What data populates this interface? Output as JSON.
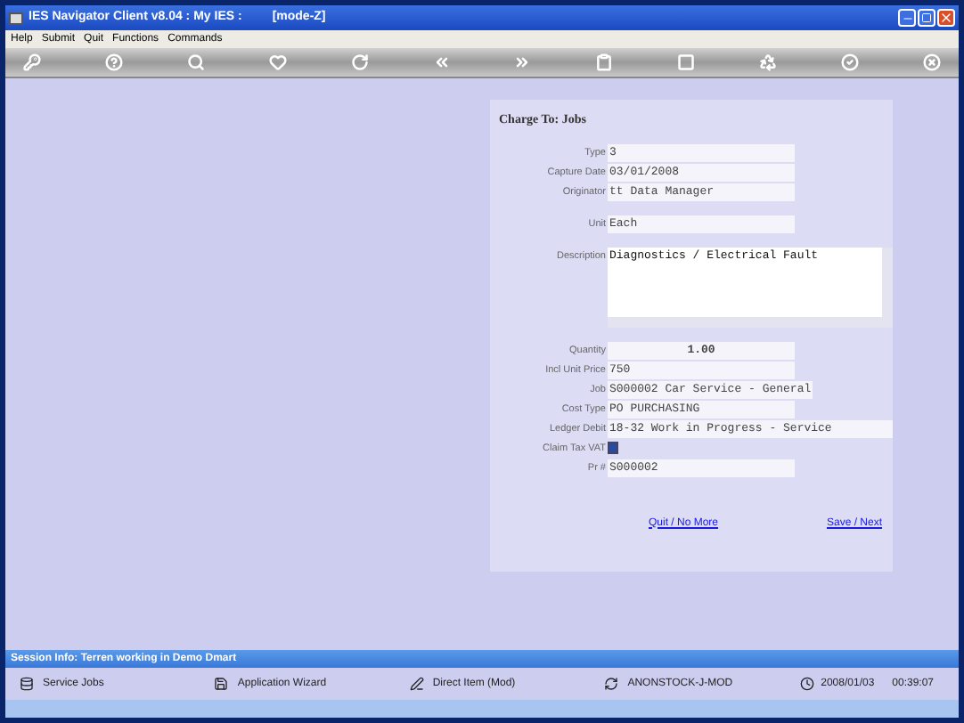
{
  "window": {
    "title": "IES Navigator Client v8.04 : My IES :",
    "mode": "[mode-Z]"
  },
  "menu": [
    "Help",
    "Submit",
    "Quit",
    "Functions",
    "Commands"
  ],
  "form": {
    "title": "Charge To: Jobs",
    "groups": [
      [
        {
          "kind": "field",
          "label": "Type",
          "value": "3"
        },
        {
          "kind": "field",
          "label": "Capture Date",
          "value": "03/01/2008"
        },
        {
          "kind": "field",
          "label": "Originator",
          "value": "tt Data Manager"
        }
      ],
      [
        {
          "kind": "field",
          "label": "Unit",
          "value": "Each"
        }
      ],
      [
        {
          "kind": "textarea",
          "label": "Description",
          "value": "Diagnostics / Electrical Fault"
        }
      ],
      [
        {
          "kind": "number",
          "label": "Quantity",
          "value": "1.00"
        },
        {
          "kind": "field",
          "label": "Incl Unit Price",
          "value": "750"
        },
        {
          "kind": "field",
          "label": "Job",
          "value": "S000002 Car Service - General"
        },
        {
          "kind": "field",
          "label": "Cost Type",
          "value": "PO PURCHASING"
        },
        {
          "kind": "wide",
          "label": "Ledger Debit",
          "value": "18-32 Work in Progress - Service"
        },
        {
          "kind": "checkbox",
          "label": "Claim Tax VAT",
          "checked": true
        },
        {
          "kind": "field",
          "label": "Pr #",
          "value": "S000002"
        }
      ]
    ],
    "links": [
      "Quit / No More",
      "Save / Next"
    ]
  },
  "session_info": "Session Info: Terren working in Demo Dmart",
  "status_bar": [
    {
      "kind": "jobs",
      "text": "Service Jobs"
    },
    {
      "kind": "wizard",
      "text": "Application Wizard"
    },
    {
      "kind": "direct",
      "text": "Direct Item (Mod)"
    },
    {
      "kind": "sync",
      "text": "ANONSTOCK-J-MOD"
    }
  ],
  "clock": {
    "date": "2008/01/03",
    "time": "00:39:07"
  }
}
